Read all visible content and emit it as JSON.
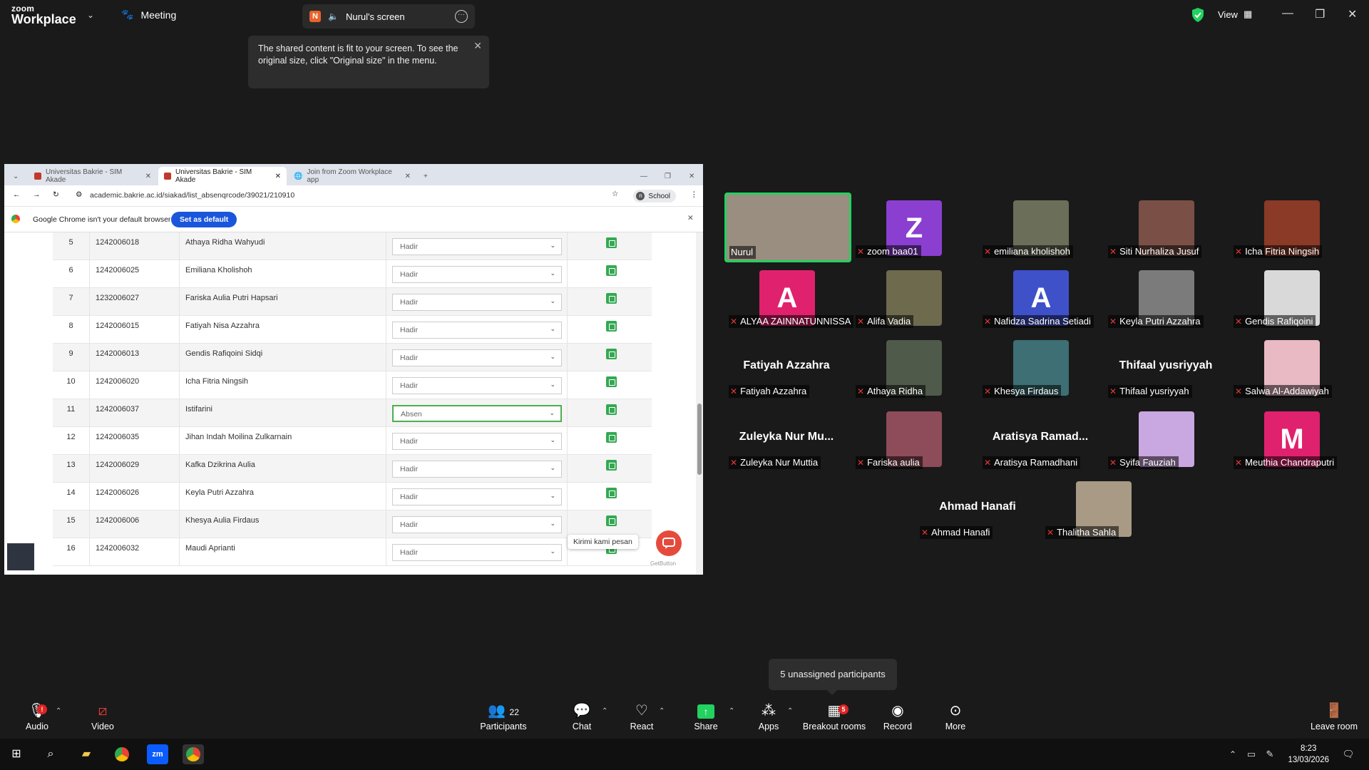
{
  "app": {
    "brand_small": "zoom",
    "brand_big": "Workplace",
    "meeting_label": "Meeting",
    "share_initial": "N",
    "share_title": "Nurul's screen",
    "view_label": "View"
  },
  "tooltip": {
    "text": "The shared content is fit to your screen. To see the original size, click \"Original size\" in the menu."
  },
  "browser": {
    "tabs": [
      {
        "label": "Universitas Bakrie - SIM Akade"
      },
      {
        "label": "Universitas Bakrie - SIM Akade"
      },
      {
        "label": "Join from Zoom Workplace app"
      }
    ],
    "url": "academic.bakrie.ac.id/siakad/list_absenqrcode/39021/210910",
    "profile": "School",
    "profile_initial": "n",
    "infobar_text": "Google Chrome isn't your default browser",
    "set_default_label": "Set as default",
    "rows": [
      {
        "no": "5",
        "nim": "1242006018",
        "name": "Athaya Ridha Wahyudi",
        "status": "Hadir"
      },
      {
        "no": "6",
        "nim": "1242006025",
        "name": "Emiliana Kholishoh",
        "status": "Hadir"
      },
      {
        "no": "7",
        "nim": "1232006027",
        "name": "Fariska Aulia Putri Hapsari",
        "status": "Hadir"
      },
      {
        "no": "8",
        "nim": "1242006015",
        "name": "Fatiyah Nisa Azzahra",
        "status": "Hadir"
      },
      {
        "no": "9",
        "nim": "1242006013",
        "name": "Gendis Rafiqoini Sidqi",
        "status": "Hadir"
      },
      {
        "no": "10",
        "nim": "1242006020",
        "name": "Icha Fitria Ningsih",
        "status": "Hadir"
      },
      {
        "no": "11",
        "nim": "1242006037",
        "name": "Istifarini",
        "status": "Absen"
      },
      {
        "no": "12",
        "nim": "1242006035",
        "name": "Jihan Indah Moilina Zulkarnain",
        "status": "Hadir"
      },
      {
        "no": "13",
        "nim": "1242006029",
        "name": "Kafka Dzikrina Aulia",
        "status": "Hadir"
      },
      {
        "no": "14",
        "nim": "1242006026",
        "name": "Keyla Putri Azzahra",
        "status": "Hadir"
      },
      {
        "no": "15",
        "nim": "1242006006",
        "name": "Khesya Aulia Firdaus",
        "status": "Hadir"
      },
      {
        "no": "16",
        "nim": "1242006032",
        "name": "Maudi Aprianti",
        "status": "Hadir"
      }
    ],
    "chat_label": "Kirimi kami pesan",
    "getbutton_label": "GetButton"
  },
  "participants": [
    {
      "name": "Nurul",
      "type": "video",
      "color": "#9a8e80",
      "muted": false,
      "speaker": true
    },
    {
      "name": "zoom baa01",
      "type": "letter",
      "letter": "Z",
      "color": "#8a3fd1",
      "muted": true
    },
    {
      "name": "emiliana kholishoh",
      "type": "photo",
      "color": "#6b6f5a",
      "muted": true
    },
    {
      "name": "Siti Nurhaliza Jusuf",
      "type": "photo",
      "color": "#7a5046",
      "muted": true
    },
    {
      "name": "Icha Fitria Ningsih",
      "type": "photo",
      "color": "#8a3a26",
      "muted": true
    },
    {
      "name": "ALYAA ZAINNATUNNISSA",
      "type": "letter",
      "letter": "A",
      "color": "#e0216e",
      "muted": true
    },
    {
      "name": "Alifa Vadia",
      "type": "photo",
      "color": "#6e6a4e",
      "muted": true
    },
    {
      "name": "Nafidza Sadrina Setiadi",
      "type": "letter",
      "letter": "A",
      "color": "#3f51c9",
      "muted": true
    },
    {
      "name": "Keyla Putri Azzahra",
      "type": "photo",
      "color": "#7b7b7b",
      "muted": true
    },
    {
      "name": "Gendis Rafiqoini",
      "type": "photo",
      "color": "#d9d9d9",
      "muted": true
    },
    {
      "name": "Fatiyah Azzahra",
      "type": "name",
      "muted": true
    },
    {
      "name": "Athaya Ridha",
      "type": "photo",
      "color": "#4f5a4a",
      "muted": true
    },
    {
      "name": "Khesya Firdaus",
      "type": "photo",
      "color": "#3d6f74",
      "muted": true
    },
    {
      "name": "Thifaal yusriyyah",
      "type": "name",
      "muted": true
    },
    {
      "name": "Salwa Al-Addawiyah",
      "type": "photo",
      "color": "#e9b9c4",
      "muted": true
    },
    {
      "name": "Zuleyka Nur Muttia",
      "type": "name",
      "big_name": "Zuleyka Nur Mu...",
      "muted": true
    },
    {
      "name": "Fariska aulia",
      "type": "photo",
      "color": "#8e4b5a",
      "muted": true
    },
    {
      "name": "Aratisya Ramadhani",
      "type": "name",
      "big_name": "Aratisya Ramad...",
      "muted": true
    },
    {
      "name": "Syifa Fauziah",
      "type": "photo",
      "color": "#c9a7e0",
      "muted": true
    },
    {
      "name": "Meuthia Chandraputri",
      "type": "letter",
      "letter": "M",
      "color": "#e0216e",
      "muted": true
    },
    {
      "name": "Ahmad Hanafi",
      "type": "name",
      "muted": true
    },
    {
      "name": "Thalitha Sahla",
      "type": "photo",
      "color": "#a89a84",
      "muted": true
    }
  ],
  "unassigned_text": "5 unassigned participants",
  "toolbar": {
    "audio": "Audio",
    "video": "Video",
    "participants": "Participants",
    "participants_count": "22",
    "chat": "Chat",
    "react": "React",
    "share": "Share",
    "apps": "Apps",
    "breakout": "Breakout rooms",
    "breakout_badge": "5",
    "record": "Record",
    "more": "More",
    "leave": "Leave room"
  },
  "taskbar": {
    "time": "8:23",
    "date": "13/03/2026",
    "notif_count": "1"
  },
  "colors": {
    "accent_green": "#23d160",
    "zoom_blue": "#0b5cff",
    "share_green": "#23d160",
    "danger": "#e02424"
  }
}
